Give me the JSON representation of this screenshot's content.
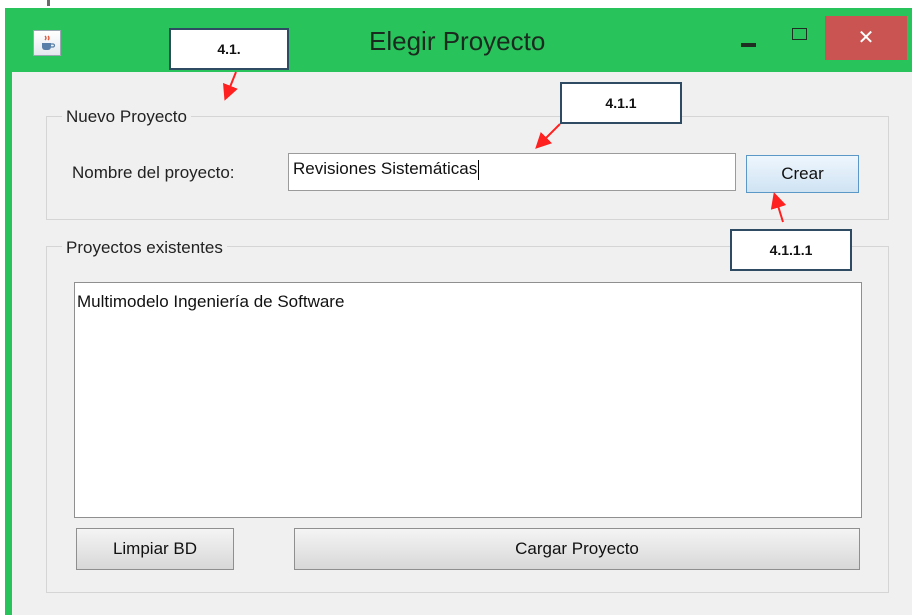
{
  "window": {
    "title": "Elegir Proyecto",
    "close_label": "✕"
  },
  "nuevo": {
    "group_title": "Nuevo Proyecto",
    "name_label": "Nombre del proyecto:",
    "name_value": "Revisiones Sistemáticas",
    "create_label": "Crear"
  },
  "existentes": {
    "group_title": "Proyectos existentes",
    "items": [
      "Multimodelo Ingeniería de Software"
    ],
    "clear_db_label": "Limpiar BD",
    "load_label": "Cargar Proyecto"
  },
  "annotations": {
    "a1": "4.1.",
    "a2": "4.1.1",
    "a3": "4.1.1.1"
  },
  "colors": {
    "titlebar": "#28c35a",
    "close_button": "#c95451",
    "annotation_arrow": "#ff2020"
  },
  "icons": {
    "app": "java-cup-icon",
    "minimize": "minimize-icon",
    "maximize": "maximize-icon",
    "close": "close-icon"
  }
}
